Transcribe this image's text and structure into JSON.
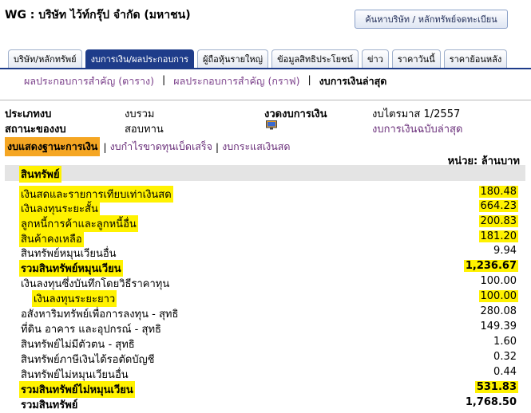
{
  "header": {
    "title": "WG : บริษัท ไว้ท์กรุ๊ป จำกัด (มหาชน)",
    "search_button": "ค้นหาบริษัท / หลักทรัพย์จดทะเบียน"
  },
  "tabs": [
    {
      "label": "บริษัท/หลักทรัพย์"
    },
    {
      "label": "งบการเงิน/ผลประกอบการ"
    },
    {
      "label": "ผู้ถือหุ้นรายใหญ่"
    },
    {
      "label": "ข้อมูลสิทธิประโยชน์"
    },
    {
      "label": "ข่าว"
    },
    {
      "label": "ราคาวันนี้"
    },
    {
      "label": "ราคาย้อนหลัง"
    }
  ],
  "subnav": {
    "item1": "ผลประกอบการสำคัญ (ตาราง)",
    "item2": "ผลประกอบการสำคัญ (กราฟ)",
    "item3": "งบการเงินล่าสุด",
    "sep": "|"
  },
  "info": {
    "type_label": "ประเภทงบ",
    "type_value": "งบรวม",
    "status_label": "สถานะของงบ",
    "status_value": "สอบทาน",
    "period_label": "งวดงบการเงิน",
    "period_value": "งบไตรมาส 1/2557",
    "full_link": "งบการเงินฉบับล่าสุด"
  },
  "fin_tabs": {
    "balance": "งบแสดงฐานะการเงิน",
    "income": "งบกำไรขาดทุนเบ็ดเสร็จ",
    "cashflow": "งบกระแสเงินสด",
    "sep": "|"
  },
  "unit_label": "หน่วย: ล้านบาท",
  "section_title": "สินทรัพย์",
  "rows": [
    {
      "label": "เงินสดและรายการเทียบเท่าเงินสด",
      "value": "180.48"
    },
    {
      "label": "เงินลงทุนระยะสั้น",
      "value": "664.23"
    },
    {
      "label": "ลูกหนี้การค้าและลูกหนี้อื่น",
      "value": "200.83"
    },
    {
      "label": "สินค้าคงเหลือ",
      "value": "181.20"
    },
    {
      "label": "สินทรัพย์หมุนเวียนอื่น",
      "value": "9.94"
    },
    {
      "label": "รวมสินทรัพย์หมุนเวียน",
      "value": "1,236.67"
    },
    {
      "label": "เงินลงทุนซึ่งบันทึกโดยวิธีราคาทุน",
      "value": "100.00"
    },
    {
      "label": "เงินลงทุนระยะยาว",
      "value": "100.00"
    },
    {
      "label": "อสังหาริมทรัพย์เพื่อการลงทุน - สุทธิ",
      "value": "280.08"
    },
    {
      "label": "ที่ดิน อาคาร และอุปกรณ์ - สุทธิ",
      "value": "149.39"
    },
    {
      "label": "สินทรัพย์ไม่มีตัวตน - สุทธิ",
      "value": "1.60"
    },
    {
      "label": "สินทรัพย์ภาษีเงินได้รอตัดบัญชี",
      "value": "0.32"
    },
    {
      "label": "สินทรัพย์ไม่หมุนเวียนอื่น",
      "value": "0.44"
    },
    {
      "label": "รวมสินทรัพย์ไม่หมุนเวียน",
      "value": "531.83"
    },
    {
      "label": "รวมสินทรัพย์",
      "value": "1,768.50"
    }
  ]
}
